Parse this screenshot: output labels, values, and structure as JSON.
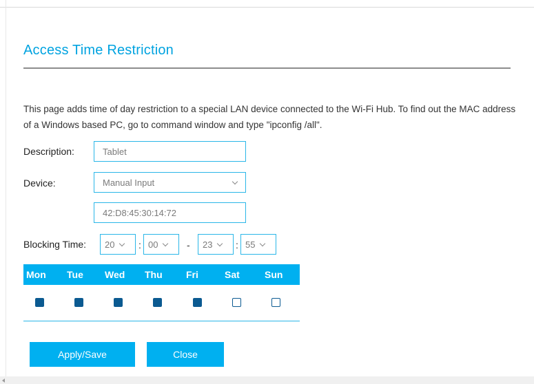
{
  "page": {
    "title": "Access Time Restriction",
    "intro": "This page adds time of day restriction to a special LAN device connected to the Wi-Fi Hub. To find out the MAC address of a Windows based PC, go to command window and type \"ipconfig /all\"."
  },
  "form": {
    "description_label": "Description:",
    "description_value": "Tablet",
    "device_label": "Device:",
    "device_selected": "Manual Input",
    "mac_value": "42:D8:45:30:14:72",
    "blocking_label": "Blocking Time:",
    "start_hour": "20",
    "start_min": "00",
    "end_hour": "23",
    "end_min": "55",
    "colon": ":",
    "dash": "-"
  },
  "days": [
    {
      "label": "Mon",
      "checked": true
    },
    {
      "label": "Tue",
      "checked": true
    },
    {
      "label": "Wed",
      "checked": true
    },
    {
      "label": "Thu",
      "checked": true
    },
    {
      "label": "Fri",
      "checked": true
    },
    {
      "label": "Sat",
      "checked": false
    },
    {
      "label": "Sun",
      "checked": false
    }
  ],
  "buttons": {
    "apply": "Apply/Save",
    "close": "Close"
  },
  "colors": {
    "accent": "#00b0f0",
    "title": "#00a3e0",
    "checkbox": "#0b5a91"
  }
}
